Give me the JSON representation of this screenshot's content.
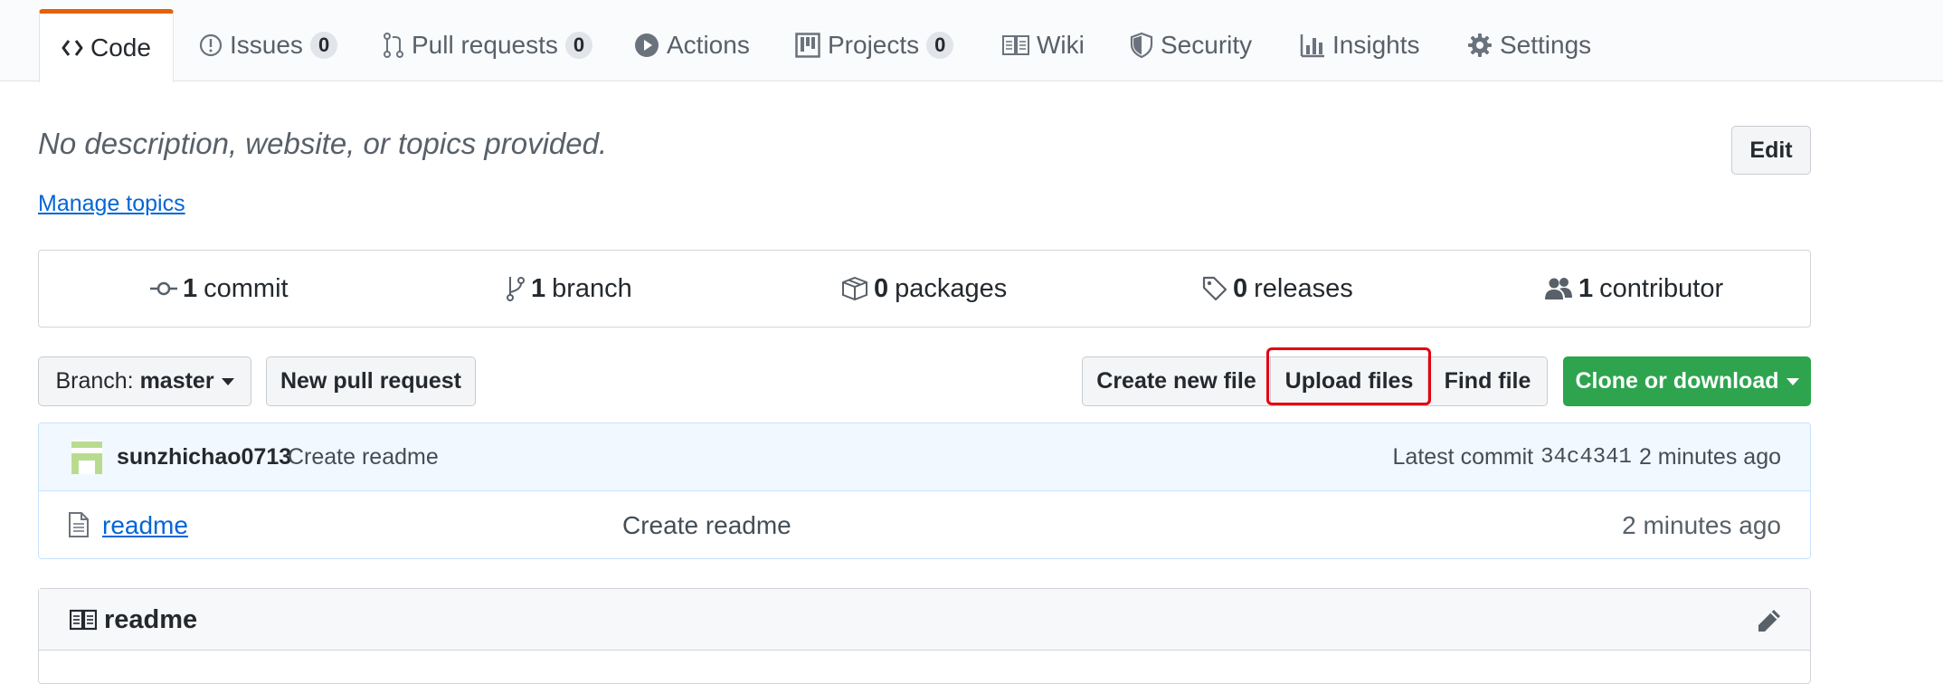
{
  "tabs": [
    {
      "label": "Code",
      "icon": "code-icon",
      "selected": true
    },
    {
      "label": "Issues",
      "icon": "issue-opened-icon",
      "count": "0"
    },
    {
      "label": "Pull requests",
      "icon": "git-pull-request-icon",
      "count": "0"
    },
    {
      "label": "Actions",
      "icon": "play-icon"
    },
    {
      "label": "Projects",
      "icon": "project-icon",
      "count": "0"
    },
    {
      "label": "Wiki",
      "icon": "book-icon"
    },
    {
      "label": "Security",
      "icon": "shield-icon"
    },
    {
      "label": "Insights",
      "icon": "graph-icon"
    },
    {
      "label": "Settings",
      "icon": "gear-icon"
    }
  ],
  "repo": {
    "description": "No description, website, or topics provided.",
    "manage_topics": "Manage topics",
    "edit_label": "Edit"
  },
  "summary": {
    "commits": {
      "count": "1",
      "label": "commit"
    },
    "branches": {
      "count": "1",
      "label": "branch"
    },
    "packages": {
      "count": "0",
      "label": "packages"
    },
    "releases": {
      "count": "0",
      "label": "releases"
    },
    "contributors": {
      "count": "1",
      "label": "contributor"
    }
  },
  "toolbar": {
    "branch_prefix": "Branch:",
    "branch_name": "master",
    "new_pull_request": "New pull request",
    "create_new_file": "Create new file",
    "upload_files": "Upload files",
    "find_file": "Find file",
    "clone_or_download": "Clone or download"
  },
  "latest_commit": {
    "author": "sunzhichao0713",
    "message": "Create readme",
    "prefix": "Latest commit",
    "sha": "34c4341",
    "age": "2 minutes ago"
  },
  "files": [
    {
      "name": "readme",
      "message": "Create readme",
      "age": "2 minutes ago"
    }
  ],
  "readme": {
    "title": "readme"
  },
  "colors": {
    "tab_accent": "#e36209",
    "link": "#0366d6",
    "clone_button": "#2ea44f",
    "highlight_box": "#e4000f",
    "commit_tease_bg": "#f1f8ff"
  }
}
